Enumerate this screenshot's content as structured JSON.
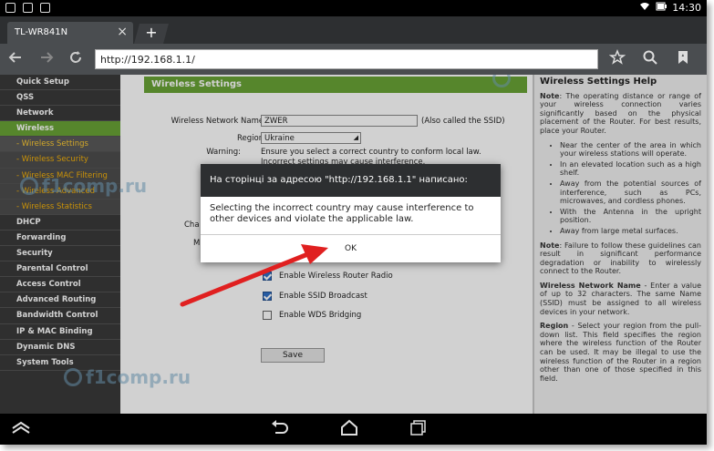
{
  "status_bar": {
    "time": "14:30"
  },
  "browser": {
    "tab_title": "TL-WR841N",
    "tab_close": "×",
    "new_tab": "+",
    "url": "http://192.168.1.1/"
  },
  "menu": {
    "items": [
      {
        "label": "Quick Setup",
        "type": "main"
      },
      {
        "label": "QSS",
        "type": "main"
      },
      {
        "label": "Network",
        "type": "main"
      },
      {
        "label": "Wireless",
        "type": "active"
      },
      {
        "label": "- Wireless Settings",
        "type": "sub-active"
      },
      {
        "label": "- Wireless Security",
        "type": "sub"
      },
      {
        "label": "- Wireless MAC Filtering",
        "type": "sub"
      },
      {
        "label": "- Wireless Advanced",
        "type": "sub"
      },
      {
        "label": "- Wireless Statistics",
        "type": "sub"
      },
      {
        "label": "DHCP",
        "type": "main"
      },
      {
        "label": "Forwarding",
        "type": "main"
      },
      {
        "label": "Security",
        "type": "main"
      },
      {
        "label": "Parental Control",
        "type": "main"
      },
      {
        "label": "Access Control",
        "type": "main"
      },
      {
        "label": "Advanced Routing",
        "type": "main"
      },
      {
        "label": "Bandwidth Control",
        "type": "main"
      },
      {
        "label": "IP & MAC Binding",
        "type": "main"
      },
      {
        "label": "Dynamic DNS",
        "type": "main"
      },
      {
        "label": "System Tools",
        "type": "main"
      }
    ]
  },
  "main": {
    "title": "Wireless Settings",
    "network_name_label": "Wireless Network Name:",
    "network_name_value": "ZWER",
    "network_name_note": "(Also called the SSID)",
    "region_label": "Region:",
    "region_value": "Ukraine",
    "warning_label": "Warning:",
    "warning_line1": "Ensure you select a correct country to conform local law.",
    "warning_line2": "Incorrect settings may cause interference.",
    "partial_label_1": "Cha",
    "partial_label_2": "M",
    "checkboxes": [
      {
        "label": "Enable Wireless Router Radio",
        "checked": true
      },
      {
        "label": "Enable SSID Broadcast",
        "checked": true
      },
      {
        "label": "Enable WDS Bridging",
        "checked": false
      }
    ],
    "save_label": "Save"
  },
  "help": {
    "title": "Wireless Settings Help",
    "note1_label": "Note",
    "note1_text": ": The operating distance or range of your wireless connection varies significantly based on the physical placement of the Router. For best results, place your Router.",
    "bullets": [
      "Near the center of the area in which your wireless stations will operate.",
      "In an elevated location such as a high shelf.",
      "Away from the potential sources of interference, such as PCs, microwaves, and cordless phones.",
      "With the Antenna in the upright position.",
      "Away from large metal surfaces."
    ],
    "note2_label": "Note",
    "note2_text": ": Failure to follow these guidelines can result in significant performance degradation or inability to wirelessly connect to the Router.",
    "wnn_label": "Wireless Network Name",
    "wnn_text": " - Enter a value of up to 32 characters. The same Name (SSID) must be assigned to all wireless devices in your network.",
    "region_label": "Region",
    "region_text": " - Select your region from the pull-down list. This field specifies the region where the wireless function of the Router can be used. It may be illegal to use the wireless function of the Router in a region other than one of those specified in this field."
  },
  "dialog": {
    "header": "На сторінці за адресою \"http://192.168.1.1\" написано:",
    "message": "Selecting the incorrect country may cause interference to other devices and violate the applicable law.",
    "ok_label": "OK"
  },
  "watermark": {
    "text": "f1comp.ru"
  },
  "colors": {
    "accent_green": "#6aa436",
    "menu_bg": "#3a3a3a",
    "sub_text": "#f6b20a",
    "arrow": "#e02020"
  }
}
